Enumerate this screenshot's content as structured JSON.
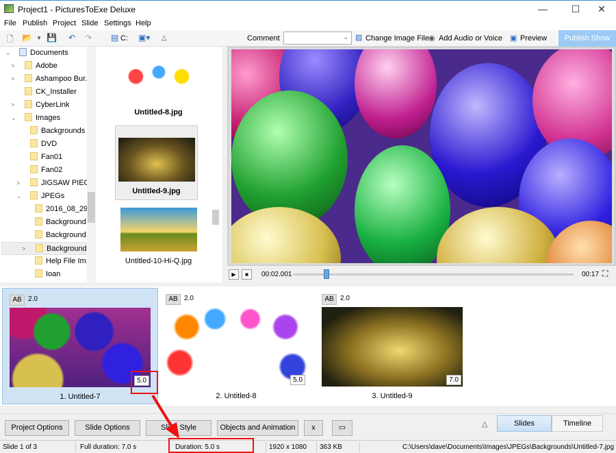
{
  "window": {
    "title": "Project1 - PicturesToExe Deluxe",
    "minimize": "—",
    "maximize": "☐",
    "close": "✕"
  },
  "menu": [
    "File",
    "Publish",
    "Project",
    "Slide",
    "Settings",
    "Help"
  ],
  "toolbar": {
    "drive_label": "C:",
    "comment_label": "Comment",
    "comment_value": "",
    "change_image": "Change Image File",
    "add_audio": "Add Audio or Voice",
    "preview": "Preview",
    "publish": "Publish Show"
  },
  "tree": [
    {
      "label": "Documents",
      "level": 0,
      "expander": "⌄"
    },
    {
      "label": "Adobe",
      "level": 1,
      "expander": ">"
    },
    {
      "label": "Ashampoo Bur...",
      "level": 1,
      "expander": ">"
    },
    {
      "label": "CK_Installer",
      "level": 1,
      "expander": ""
    },
    {
      "label": "CyberLink",
      "level": 1,
      "expander": ">"
    },
    {
      "label": "Images",
      "level": 1,
      "expander": "⌄"
    },
    {
      "label": "Backgrounds",
      "level": 2,
      "expander": ""
    },
    {
      "label": "DVD",
      "level": 2,
      "expander": ""
    },
    {
      "label": "Fan01",
      "level": 2,
      "expander": ""
    },
    {
      "label": "Fan02",
      "level": 2,
      "expander": ""
    },
    {
      "label": "JIGSAW PIECES",
      "level": 2,
      "expander": ">"
    },
    {
      "label": "JPEGs",
      "level": 2,
      "expander": "⌄"
    },
    {
      "label": "2016_08_29",
      "level": 3,
      "expander": ""
    },
    {
      "label": "Background...",
      "level": 3,
      "expander": ""
    },
    {
      "label": "Background...",
      "level": 3,
      "expander": ""
    },
    {
      "label": "Backgrounds",
      "level": 3,
      "expander": ">",
      "selected": true
    },
    {
      "label": "Help File Im...",
      "level": 3,
      "expander": ""
    },
    {
      "label": "Ioan",
      "level": 3,
      "expander": ""
    }
  ],
  "files": [
    {
      "name": "Untitled-8.jpg",
      "bold": true
    },
    {
      "name": "Untitled-9.jpg",
      "bold": true,
      "selected": true
    },
    {
      "name": "Untitled-10-Hi-Q.jpg",
      "bold": false
    }
  ],
  "player": {
    "current_time": "00:02.001",
    "total_time": "00:17",
    "progress": 0.12
  },
  "slides": [
    {
      "caption": "1. Untitled-7",
      "transition": "AB",
      "transition_time": "2.0",
      "duration": "5.0",
      "selected": true
    },
    {
      "caption": "2. Untitled-8",
      "transition": "AB",
      "transition_time": "2.0",
      "duration": "5.0"
    },
    {
      "caption": "3. Untitled-9",
      "transition": "AB",
      "transition_time": "2.0",
      "duration": "7.0"
    }
  ],
  "buttons": {
    "project_options": "Project Options",
    "slide_options": "Slide Options",
    "slide_style": "Slide Style",
    "objects": "Objects and Animation",
    "x": "x"
  },
  "tabs": {
    "collapse": "△",
    "slides": "Slides",
    "timeline": "Timeline"
  },
  "status": {
    "slide": "Slide 1 of 3",
    "full_duration": "Full duration: 7.0 s",
    "duration": "Duration: 5.0 s",
    "resolution": "1920 x 1080",
    "size": "363 KB",
    "path": "C:\\Users\\dave\\Documents\\Images\\JPEGs\\Backgrounds\\Untitled-7.jpg"
  },
  "colors": {
    "accent": "#9ccaf4",
    "annotation": "#ee1111",
    "selection": "#cfe3f5"
  }
}
